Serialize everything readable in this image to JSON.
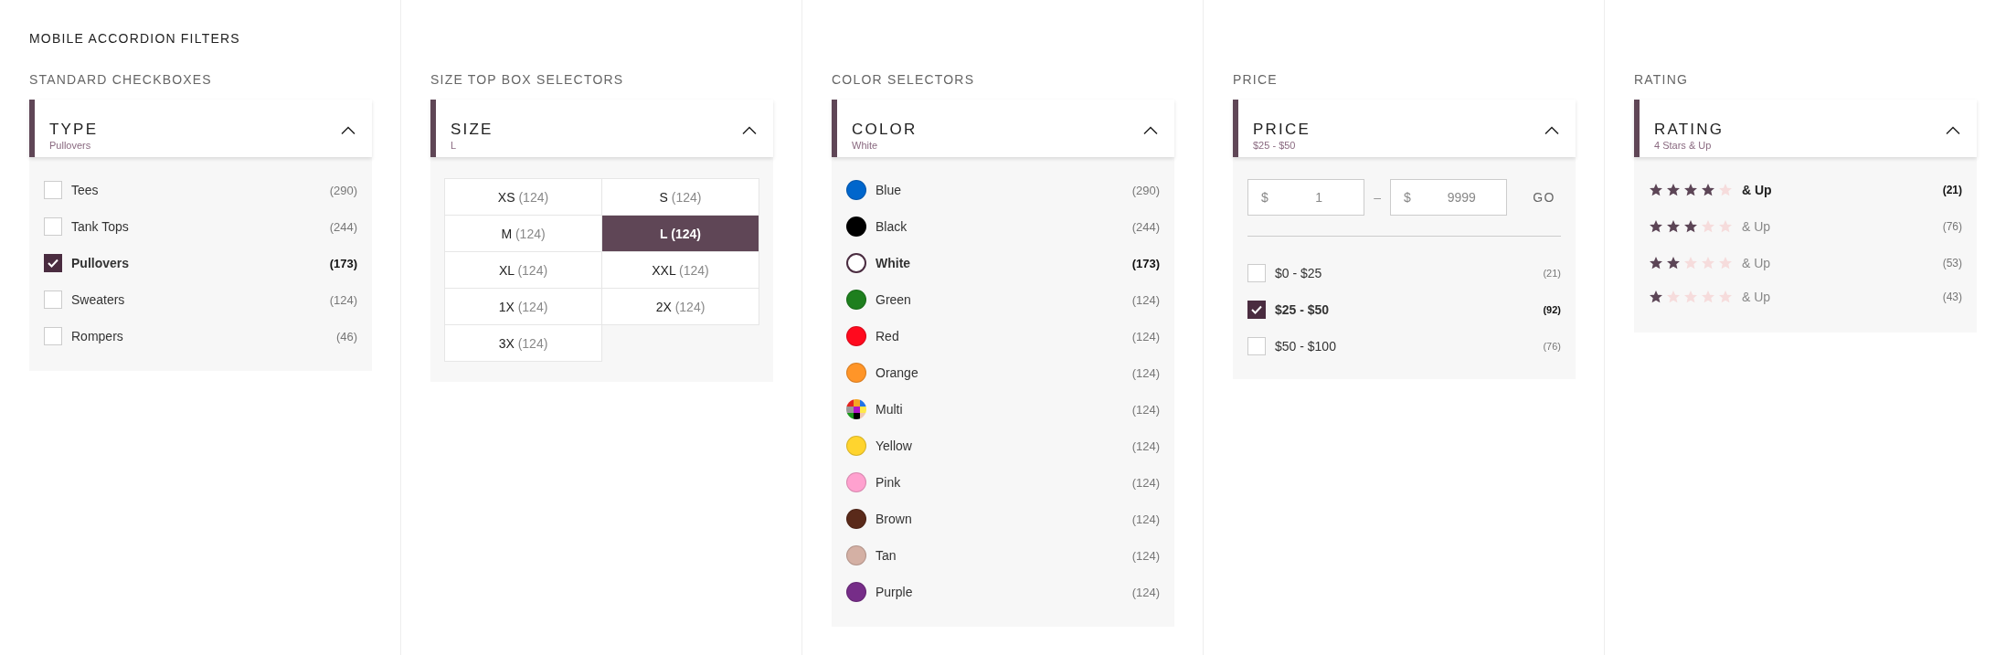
{
  "page_title": "MOBILE ACCORDION FILTERS",
  "sections": [
    {
      "kind": "checkboxes",
      "label": "STANDARD CHECKBOXES",
      "filter": {
        "title": "TYPE",
        "summary": "Pullovers",
        "expanded": true
      },
      "options": [
        {
          "label": "Tees",
          "count": "(290)",
          "checked": false
        },
        {
          "label": "Tank Tops",
          "count": "(244)",
          "checked": false
        },
        {
          "label": "Pullovers",
          "count": "(173)",
          "checked": true
        },
        {
          "label": "Sweaters",
          "count": "(124)",
          "checked": false
        },
        {
          "label": "Rompers",
          "count": "(46)",
          "checked": false
        }
      ]
    },
    {
      "kind": "sizes",
      "label": "SIZE TOP BOX SELECTORS",
      "filter": {
        "title": "SIZE",
        "summary": "L",
        "expanded": true
      },
      "options": [
        {
          "label": "XS",
          "count": "(124)",
          "selected": false
        },
        {
          "label": "S",
          "count": "(124)",
          "selected": false
        },
        {
          "label": "M",
          "count": "(124)",
          "selected": false
        },
        {
          "label": "L",
          "count": "(124)",
          "selected": true
        },
        {
          "label": "XL",
          "count": "(124)",
          "selected": false
        },
        {
          "label": "XXL",
          "count": "(124)",
          "selected": false
        },
        {
          "label": "1X",
          "count": "(124)",
          "selected": false
        },
        {
          "label": "2X",
          "count": "(124)",
          "selected": false
        },
        {
          "label": "3X",
          "count": "(124)",
          "selected": false
        }
      ]
    },
    {
      "kind": "colors",
      "label": "COLOR SELECTORS",
      "filter": {
        "title": "COLOR",
        "summary": "White",
        "expanded": true
      },
      "options": [
        {
          "kind": "solid",
          "label": "Blue",
          "count": "(290)",
          "color": "#0066cc",
          "selected": false
        },
        {
          "kind": "solid",
          "label": "Black",
          "count": "(244)",
          "color": "#000000",
          "selected": false
        },
        {
          "kind": "solid",
          "label": "White",
          "count": "(173)",
          "color": "#ffffff",
          "selected": true
        },
        {
          "kind": "solid",
          "label": "Green",
          "count": "(124)",
          "color": "#1e7f1e",
          "selected": false
        },
        {
          "kind": "solid",
          "label": "Red",
          "count": "(124)",
          "color": "#ff0a1e",
          "selected": false
        },
        {
          "kind": "solid",
          "label": "Orange",
          "count": "(124)",
          "color": "#ff9528",
          "selected": false
        },
        {
          "kind": "multi",
          "label": "Multi",
          "count": "(124)",
          "selected": false
        },
        {
          "kind": "solid",
          "label": "Yellow",
          "count": "(124)",
          "color": "#ffd42e",
          "selected": false
        },
        {
          "kind": "solid",
          "label": "Pink",
          "count": "(124)",
          "color": "#ffa1cf",
          "selected": false
        },
        {
          "kind": "solid",
          "label": "Brown",
          "count": "(124)",
          "color": "#5a2a1a",
          "selected": false
        },
        {
          "kind": "solid",
          "label": "Tan",
          "count": "(124)",
          "color": "#d4b0a4",
          "selected": false
        },
        {
          "kind": "solid",
          "label": "Purple",
          "count": "(124)",
          "color": "#762d88",
          "selected": false
        }
      ]
    },
    {
      "kind": "price",
      "label": "PRICE",
      "filter": {
        "title": "PRICE",
        "summary": "$25 - $50",
        "expanded": true
      },
      "min_field": {
        "prefix": "$",
        "value": "1"
      },
      "separator": "–",
      "max_field": {
        "prefix": "$",
        "value": "9999"
      },
      "go_button": "GO",
      "options": [
        {
          "label": "$0 - $25",
          "count": "(21)",
          "checked": false
        },
        {
          "label": "$25 - $50",
          "count": "(92)",
          "checked": true
        },
        {
          "label": "$50 - $100",
          "count": "(76)",
          "checked": false
        }
      ]
    },
    {
      "kind": "rating",
      "label": "RATING",
      "filter": {
        "title": "RATING",
        "summary": "4 Stars & Up",
        "expanded": true
      },
      "options": [
        {
          "stars": 4,
          "label": "& Up",
          "count": "(21)",
          "selected": true
        },
        {
          "stars": 3,
          "label": "& Up",
          "count": "(76)",
          "selected": false
        },
        {
          "stars": 2,
          "label": "& Up",
          "count": "(53)",
          "selected": false
        },
        {
          "stars": 1,
          "label": "& Up",
          "count": "(43)",
          "selected": false
        }
      ]
    }
  ]
}
